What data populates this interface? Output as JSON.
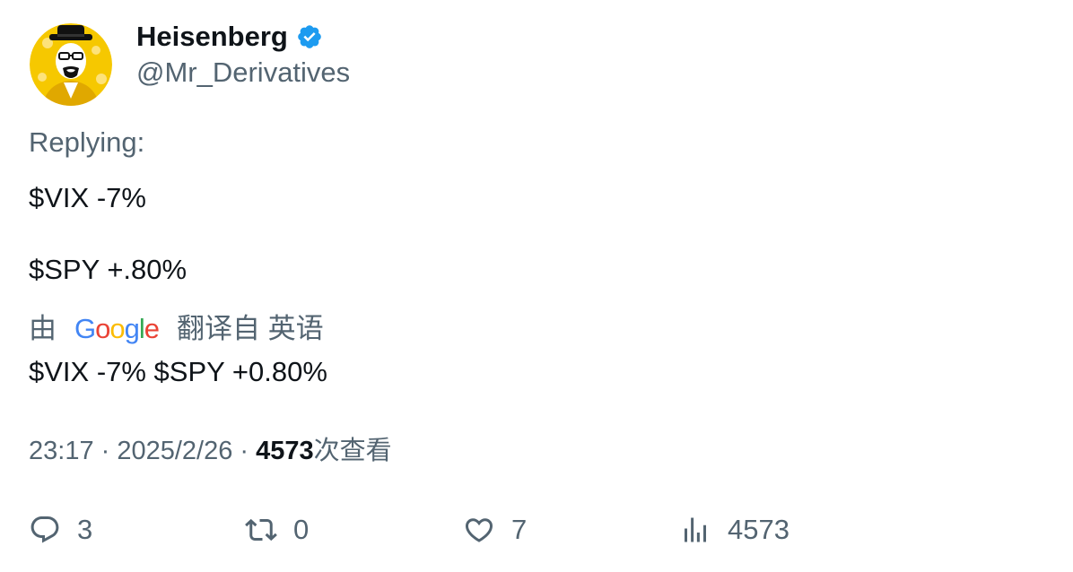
{
  "author": {
    "display_name": "Heisenberg",
    "handle": "@Mr_Derivatives",
    "verified": true,
    "avatar_icon": "heisenberg-avatar",
    "avatar_bg_color": "#f6c800"
  },
  "replying_label": "Replying:",
  "tweet_lines": [
    "$VIX -7%",
    "$SPY +.80%"
  ],
  "translation": {
    "prefix": "由",
    "provider": [
      "G",
      "o",
      "o",
      "g",
      "l",
      "e"
    ],
    "provider_colors": [
      "#4285f4",
      "#ea4335",
      "#fbbc05",
      "#4285f4",
      "#34a853",
      "#ea4335"
    ],
    "suffix": "翻译自 英语",
    "text": "$VIX -7% $SPY +0.80%"
  },
  "meta": {
    "time": "23:17",
    "separator": " · ",
    "date": "2025/2/26",
    "views_count": "4573",
    "views_label": "次查看"
  },
  "actions": {
    "reply": {
      "icon": "reply-icon",
      "count": "3"
    },
    "retweet": {
      "icon": "retweet-icon",
      "count": "0"
    },
    "like": {
      "icon": "heart-icon",
      "count": "7"
    },
    "views": {
      "icon": "analytics-icon",
      "count": "4573"
    }
  },
  "colors": {
    "text_primary": "#0f1419",
    "text_secondary": "#536471",
    "verified_blue": "#1d9bf0"
  }
}
